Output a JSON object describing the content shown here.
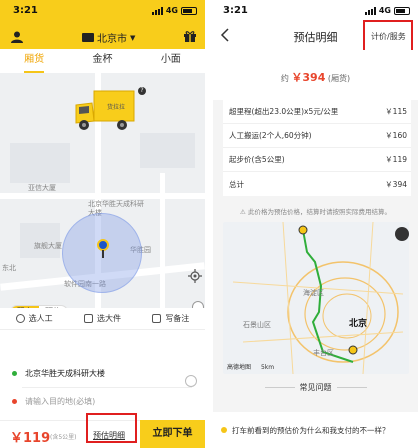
{
  "left": {
    "status": {
      "time": "3:21",
      "network": "4G"
    },
    "header": {
      "city": "北京市"
    },
    "tabs": [
      "厢货",
      "金杯",
      "小面"
    ],
    "map": {
      "places": [
        "亚信大厦",
        "北京华胜天成科研大楼",
        "旗舰大厦",
        "华胜园",
        "软件园南一路",
        "东北"
      ]
    },
    "mode": {
      "now": "现在",
      "book": "预约"
    },
    "options": [
      "选人工",
      "选大件",
      "写备注"
    ],
    "pickup": "北京华胜天成科研大楼",
    "destination_placeholder": "请输入目的地(必填)",
    "bottom": {
      "price": "￥119",
      "price_note": "(含5公里)",
      "estimate_link": "预估明细",
      "order_button": "立即下单"
    }
  },
  "right": {
    "status": {
      "time": "3:21",
      "network": "4G"
    },
    "title": "预估明细",
    "rule_link": "计价/服务",
    "total_prefix": "约",
    "total_amount": "￥394",
    "total_suffix": "(厢货)",
    "rows": [
      {
        "label": "超里程(超出23.0公里)x5元/公里",
        "value": "￥115"
      },
      {
        "label": "人工搬运(2个人,60分钟)",
        "value": "￥160"
      },
      {
        "label": "起步价(含5公里)",
        "value": "￥119"
      },
      {
        "label": "总计",
        "value": "￥394"
      }
    ],
    "note": "此价格为预估价格，结算时请按照实际费用结算。",
    "map_labels": [
      "海淀区",
      "石景山区",
      "北京",
      "丰台区",
      "高德地图",
      "5km"
    ],
    "faq_title": "常见问题",
    "faq_item": "打车前看到的预估价为什么和我支付的不一样？"
  },
  "colors": {
    "brand_yellow": "#f8cd1b",
    "price_red": "#e8452c",
    "highlight_red": "#e01f1f",
    "route_green": "#2fae3a"
  }
}
